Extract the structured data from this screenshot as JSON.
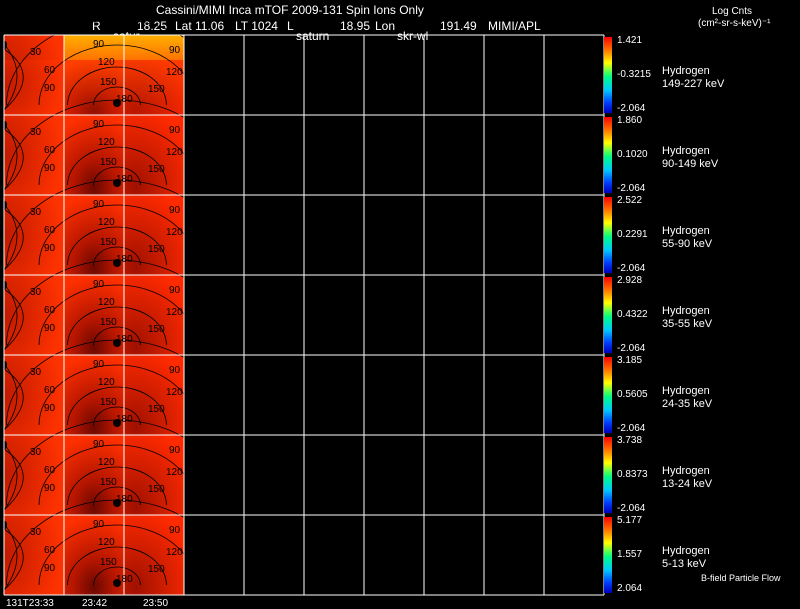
{
  "header": {
    "title": "Cassini/MIMI Inca mTOF  2009-131   Spin    Ions Only",
    "r_label": "R",
    "r_val": "18.25",
    "lat_text": "Lat 11.06",
    "lt_text": "LT 1024",
    "l_text": "L",
    "lon_val": "18.95",
    "lon_label": "Lon",
    "right_val": "191.49",
    "credit": "MIMI/APL",
    "satur": "satur",
    "saturn": "saturn",
    "skr": "skr-wl",
    "units_line1": "Log Cnts",
    "units_line2": "(cm²-sr-s-keV)⁻¹"
  },
  "panels": [
    {
      "species": "Hydrogen",
      "energy": "149-227 keV",
      "max": "1.421",
      "mid": "-0.3215",
      "min": "-2.064"
    },
    {
      "species": "Hydrogen",
      "energy": "90-149 keV",
      "max": "1.860",
      "mid": "0.1020",
      "min": "-2.064"
    },
    {
      "species": "Hydrogen",
      "energy": "55-90 keV",
      "max": "2.522",
      "mid": "0.2291",
      "min": "-2.064"
    },
    {
      "species": "Hydrogen",
      "energy": "35-55 keV",
      "max": "2.928",
      "mid": "0.4322",
      "min": "-2.064"
    },
    {
      "species": "Hydrogen",
      "energy": "24-35 keV",
      "max": "3.185",
      "mid": "0.5605",
      "min": "-2.064"
    },
    {
      "species": "Hydrogen",
      "energy": "13-24 keV",
      "max": "3.738",
      "mid": "0.8373",
      "min": "-2.064"
    },
    {
      "species": "Hydrogen",
      "energy": "5-13 keV",
      "max": "5.177",
      "mid": "1.557",
      "min": "2.064"
    }
  ],
  "contour_labels": [
    "30",
    "60",
    "90",
    "90",
    "120",
    "150",
    "180",
    "90",
    "120",
    "150"
  ],
  "footer": {
    "t0": "131T23:33",
    "t1": "23:42",
    "t2": "23:50",
    "bfield": "B-field Particle Flow"
  },
  "colors": {
    "grid": "#ffffff",
    "image_bright": "#ff2200",
    "image_dark": "#b01000"
  }
}
